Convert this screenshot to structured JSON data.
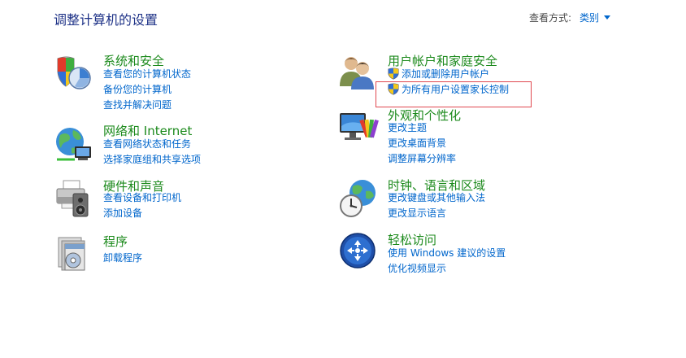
{
  "header": {
    "title": "调整计算机的设置",
    "view_by_label": "查看方式:",
    "view_by_value": "类别"
  },
  "categories": [
    {
      "title": "系统和安全",
      "icon": "shield-computer-icon",
      "links": [
        "查看您的计算机状态",
        "备份您的计算机",
        "查找并解决问题"
      ]
    },
    {
      "title": "网络和 Internet",
      "icon": "network-globe-icon",
      "links": [
        "查看网络状态和任务",
        "选择家庭组和共享选项"
      ]
    },
    {
      "title": "硬件和声音",
      "icon": "printer-speaker-icon",
      "links": [
        "查看设备和打印机",
        "添加设备"
      ]
    },
    {
      "title": "程序",
      "icon": "programs-box-icon",
      "links": [
        "卸载程序"
      ]
    },
    {
      "title": "用户帐户和家庭安全",
      "icon": "users-icon",
      "links": [
        "添加或删除用户帐户",
        "为所有用户设置家长控制"
      ]
    },
    {
      "title": "外观和个性化",
      "icon": "monitor-palette-icon",
      "links": [
        "更改主题",
        "更改桌面背景",
        "调整屏幕分辨率"
      ]
    },
    {
      "title": "时钟、语言和区域",
      "icon": "clock-globe-icon",
      "links": [
        "更改键盘或其他输入法",
        "更改显示语言"
      ]
    },
    {
      "title": "轻松访问",
      "icon": "ease-of-access-icon",
      "links": [
        "使用 Windows 建议的设置",
        "优化视频显示"
      ]
    }
  ],
  "colors": {
    "category_title": "#1c8a1c",
    "link": "#0066cc",
    "page_title": "#1e3287",
    "highlight_box": "#e0484f"
  }
}
